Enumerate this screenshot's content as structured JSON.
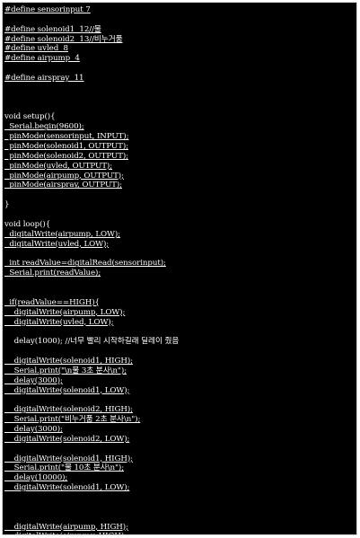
{
  "editor": {
    "background": "#000000",
    "text_color": "#ffffff",
    "lines": [
      "#define sensorinput 7",
      "",
      "#define solenoid1  12//물",
      "#define solenoid2  13//비누거품",
      "#define uvled  8",
      "#define airpump  4",
      "",
      "#define airspray  11",
      "",
      "",
      "",
      "void setup(){",
      "  Serial.begin(9600);",
      "  pinMode(sensorinput, INPUT);",
      "  pinMode(solenoid1, OUTPUT);",
      "  pinMode(solenoid2, OUTPUT);",
      "  pinMode(uvled, OUTPUT);",
      "  pinMode(airpump, OUTPUT);",
      "  pinMode(airspray, OUTPUT);",
      "",
      "}",
      "",
      "void loop(){",
      "  digitalWrite(airpump, LOW);",
      "  digitalWrite(uvled, LOW);",
      "",
      "  int readValue=digitalRead(sensorinput);",
      "  Serial.print(readValue);",
      "",
      "",
      "  if(readValue==HIGH){",
      "    digitalWrite(airpump, LOW);",
      "    digitalWrite(uvled, LOW);",
      "",
      "    delay(1000); //너무 빨리 시작하길래 딜레이 줬음",
      "",
      "    digitalWrite(solenoid1, HIGH);",
      "    Serial.print(\"\\n물 3초 분사\\n\");",
      "    delay(3000);",
      "    digitalWrite(solenoid1, LOW);",
      "",
      "    digitalWrite(solenoid2, HIGH);",
      "    Serial.print(\"비누거품 2초 분사\\n\");",
      "    delay(3000);",
      "    digitalWrite(solenoid2, LOW);",
      "",
      "    digitalWrite(solenoid1, HIGH);",
      "    Serial.print(\"물 10초 분사\\n\");",
      "    delay(10000);",
      "    digitalWrite(solenoid1, LOW);",
      "",
      "",
      "",
      "    digitalWrite(airpump, HIGH);",
      "    digitalWrite(airspray, HIGH);"
    ]
  }
}
